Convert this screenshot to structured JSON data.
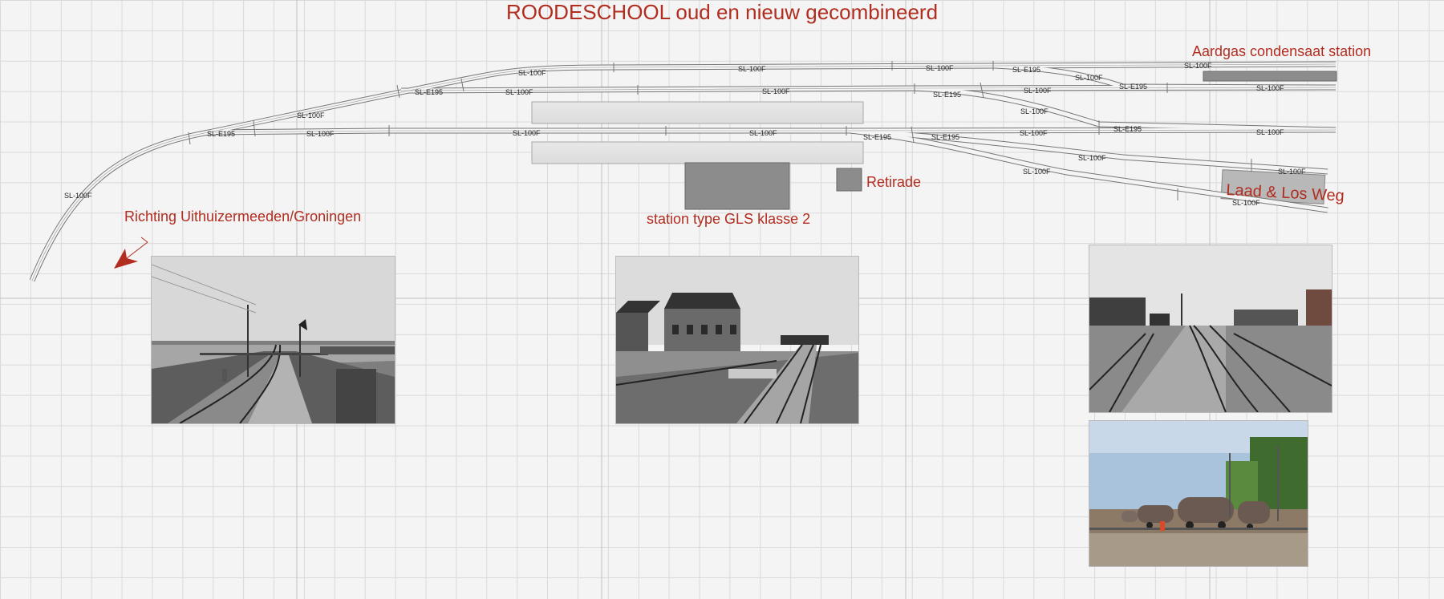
{
  "title": "ROODESCHOOL oud en nieuw gecombineerd",
  "labels": {
    "condensate_station": "Aardgas condensaat station",
    "retirade": "Retirade",
    "load_unload_road": "Laad & Los Weg",
    "station_building": "station type GLS klasse 2",
    "direction": "Richting Uithuizermeeden/Groningen"
  },
  "track_pieces": {
    "straight": "SL-100F",
    "switch": "SL-E195"
  },
  "photos": [
    {
      "name": "photo-level-crossing",
      "tone": "grayscale"
    },
    {
      "name": "photo-station-building",
      "tone": "grayscale"
    },
    {
      "name": "photo-yard-tracks",
      "tone": "grayscale"
    },
    {
      "name": "photo-tank-wagons",
      "tone": "color"
    }
  ],
  "colors": {
    "accent_red": "#b22d20",
    "platform": "#e3e3e3",
    "building": "#8a8a8a",
    "grid": "#d9d9d9"
  }
}
